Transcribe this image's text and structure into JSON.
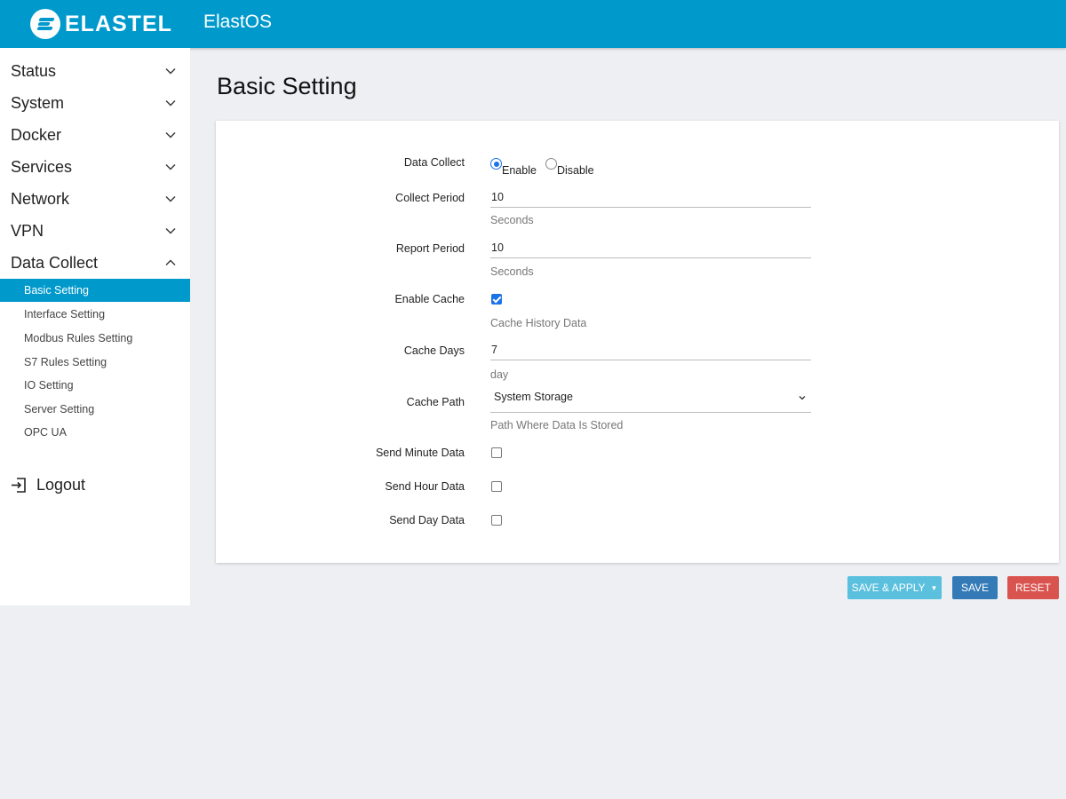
{
  "header": {
    "logo_text": "ELASTEL",
    "app_title": "ElastOS"
  },
  "sidebar": {
    "items": [
      {
        "label": "Status",
        "expanded": false
      },
      {
        "label": "System",
        "expanded": false
      },
      {
        "label": "Docker",
        "expanded": false
      },
      {
        "label": "Services",
        "expanded": false
      },
      {
        "label": "Network",
        "expanded": false
      },
      {
        "label": "VPN",
        "expanded": false
      },
      {
        "label": "Data Collect",
        "expanded": true
      }
    ],
    "sub_items": [
      {
        "label": "Basic Setting",
        "active": true
      },
      {
        "label": "Interface Setting"
      },
      {
        "label": "Modbus Rules Setting"
      },
      {
        "label": "S7 Rules Setting"
      },
      {
        "label": "IO Setting"
      },
      {
        "label": "Server Setting"
      },
      {
        "label": "OPC UA"
      }
    ],
    "logout": "Logout"
  },
  "page": {
    "title": "Basic Setting"
  },
  "form": {
    "data_collect": {
      "label": "Data Collect",
      "options": [
        "Enable",
        "Disable"
      ],
      "selected": "Enable"
    },
    "collect_period": {
      "label": "Collect Period",
      "value": "10",
      "hint": "Seconds"
    },
    "report_period": {
      "label": "Report Period",
      "value": "10",
      "hint": "Seconds"
    },
    "enable_cache": {
      "label": "Enable Cache",
      "checked": true,
      "hint": "Cache History Data"
    },
    "cache_days": {
      "label": "Cache Days",
      "value": "7",
      "hint": "day"
    },
    "cache_path": {
      "label": "Cache Path",
      "value": "System Storage",
      "hint": "Path Where Data Is Stored"
    },
    "send_minute": {
      "label": "Send Minute Data",
      "checked": false
    },
    "send_hour": {
      "label": "Send Hour Data",
      "checked": false
    },
    "send_day": {
      "label": "Send Day Data",
      "checked": false
    }
  },
  "buttons": {
    "save_apply": "SAVE & APPLY",
    "save": "SAVE",
    "reset": "RESET"
  },
  "colors": {
    "brand": "#0099cc",
    "accent": "#1a73e8",
    "apply": "#5bc0de",
    "save": "#337ab7",
    "reset": "#d9534f"
  }
}
